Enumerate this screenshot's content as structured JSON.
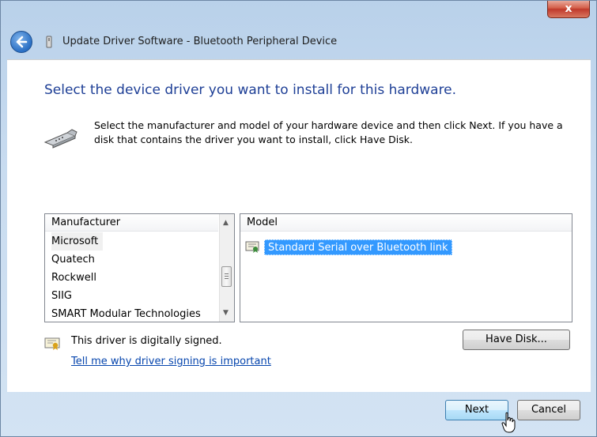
{
  "window": {
    "close_label": "x",
    "title": "Update Driver Software - Bluetooth Peripheral Device"
  },
  "content": {
    "heading": "Select the device driver you want to install for this hardware.",
    "instruction": "Select the manufacturer and model of your hardware device and then click Next. If you have a disk that contains the driver you want to install, click Have Disk."
  },
  "manufacturer_list": {
    "header": "Manufacturer",
    "items": [
      "Microsoft",
      "Quatech",
      "Rockwell",
      "SIIG",
      "SMART Modular Technologies"
    ],
    "selected": "Microsoft"
  },
  "model_list": {
    "header": "Model",
    "items": [
      "Standard Serial over Bluetooth link"
    ],
    "selected": "Standard Serial over Bluetooth link"
  },
  "signing": {
    "status_text": "This driver is digitally signed.",
    "link_text": "Tell me why driver signing is important"
  },
  "buttons": {
    "have_disk": "Have Disk...",
    "next": "Next",
    "cancel": "Cancel"
  },
  "colors": {
    "heading": "#1e3f96",
    "selection": "#3399ff",
    "link": "#0645ad"
  }
}
